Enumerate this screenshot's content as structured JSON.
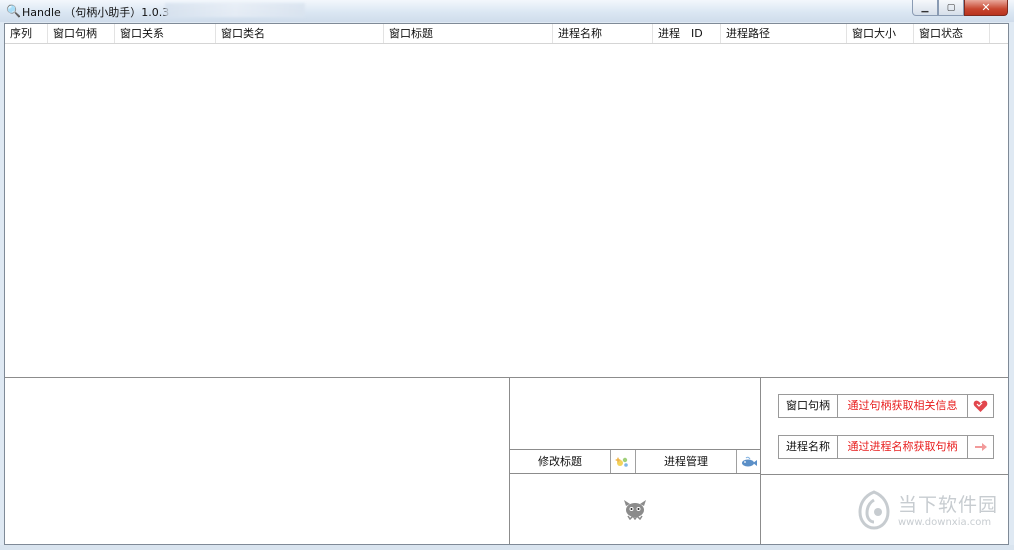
{
  "window": {
    "title": "Handle （句柄小助手）1.0.3",
    "min_symbol": "▁",
    "max_symbol": "▢",
    "close_symbol": "✕"
  },
  "listview": {
    "columns": [
      "序列",
      "窗口句柄",
      "窗口关系",
      "窗口类名",
      "窗口标题",
      "进程名称",
      "进程　ID",
      "进程路径",
      "窗口大小",
      "窗口状态"
    ],
    "rows": []
  },
  "middle_panel": {
    "edit_title_label": "修改标题",
    "edit_title_icon": "sparkle-icon",
    "process_mgmt_label": "进程管理",
    "process_mgmt_icon": "fish-icon",
    "bottom_icon": "ghost-icon"
  },
  "right_panel": {
    "handle_label": "窗口句柄",
    "handle_action": "通过句柄获取相关信息",
    "handle_icon": "heart-icon",
    "process_label": "进程名称",
    "process_action": "通过进程名称获取句柄",
    "process_icon": "arrow-icon"
  },
  "watermark": {
    "text": "当下软件园",
    "url": "www.downxia.com"
  },
  "colors": {
    "action_text": "#e81e1e",
    "border": "#8c8c8c",
    "heart": "#e2474d"
  }
}
